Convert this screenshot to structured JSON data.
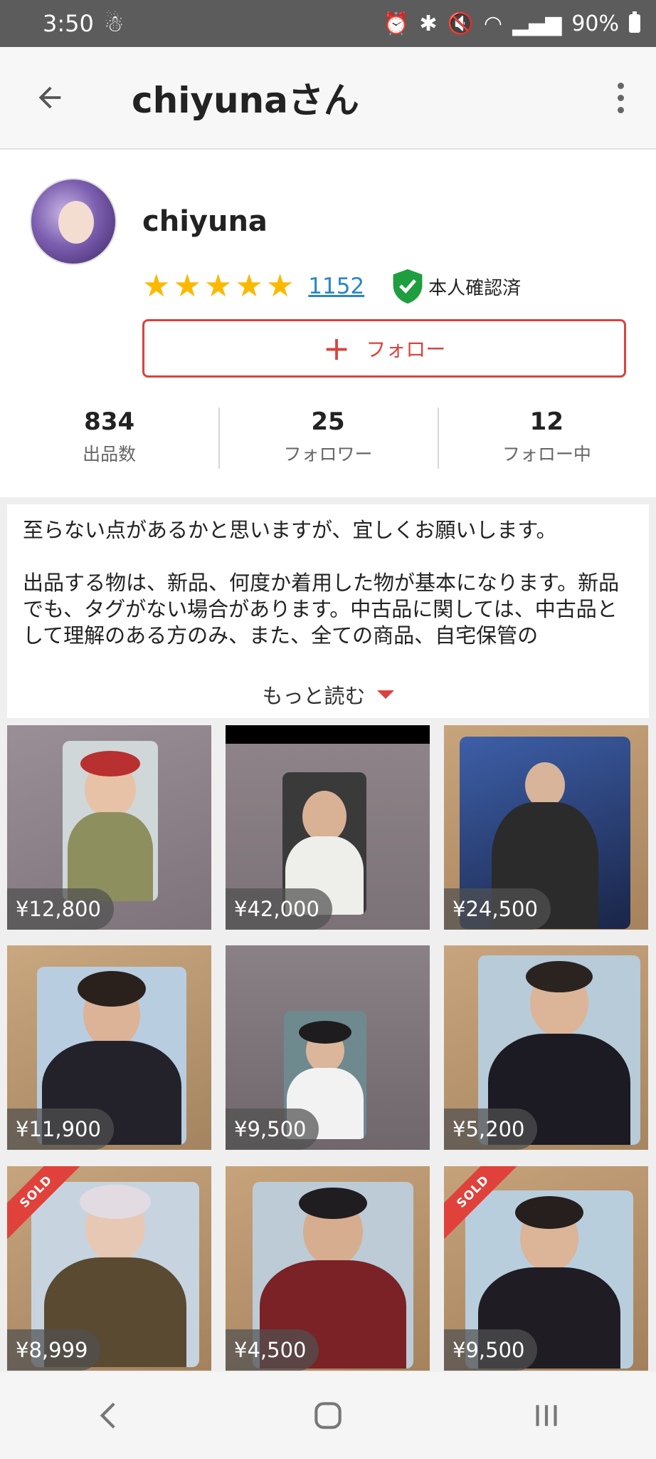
{
  "status_bar": {
    "time": "3:50",
    "battery": "90%"
  },
  "app_bar": {
    "title": "chiyunaさん"
  },
  "profile": {
    "username": "chiyuna",
    "rating_stars": 5,
    "review_count": "1152",
    "verified_label": "本人確認済",
    "follow_label": "フォロー",
    "stats": [
      {
        "value": "834",
        "label": "出品数"
      },
      {
        "value": "25",
        "label": "フォロワー"
      },
      {
        "value": "12",
        "label": "フォロー中"
      }
    ]
  },
  "bio": {
    "line1": "至らない点があるかと思いますが、宜しくお願いします。",
    "para2": "出品する物は、新品、何度か着用した物が基本になります。新品でも、タグがない場合があります。中古品に関しては、中古品として理解のある方のみ、また、全ての商品、自宅保管の",
    "read_more": "もっと読む"
  },
  "items": [
    {
      "price": "¥12,800",
      "sold": false
    },
    {
      "price": "¥42,000",
      "sold": false
    },
    {
      "price": "¥24,500",
      "sold": false
    },
    {
      "price": "¥11,900",
      "sold": false
    },
    {
      "price": "¥9,500",
      "sold": false
    },
    {
      "price": "¥5,200",
      "sold": false
    },
    {
      "price": "¥8,999",
      "sold": true,
      "sold_label": "SOLD"
    },
    {
      "price": "¥4,500",
      "sold": false
    },
    {
      "price": "¥9,500",
      "sold": true,
      "sold_label": "SOLD"
    }
  ],
  "colors": {
    "accent": "#d9433c",
    "star": "#fbb900",
    "link": "#2a85c9",
    "verified": "#1e9e3f"
  }
}
